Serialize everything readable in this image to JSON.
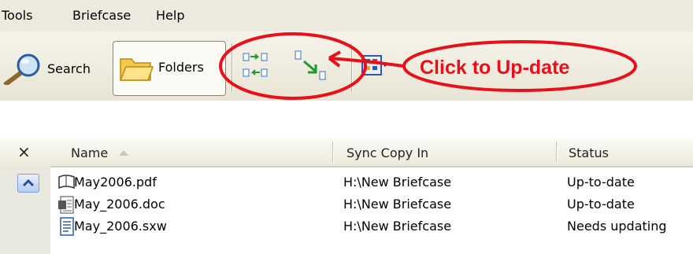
{
  "menu": {
    "tools": "Tools",
    "briefcase": "Briefcase",
    "help": "Help"
  },
  "toolbar": {
    "search_label": "Search",
    "folders_label": "Folders"
  },
  "annotation": {
    "text": "Click to Up-date",
    "color": "#e8101a"
  },
  "list": {
    "close_symbol": "×",
    "columns": {
      "name": "Name",
      "sync": "Sync Copy In",
      "status": "Status"
    },
    "rows": [
      {
        "name": "May2006.pdf",
        "sync": "H:\\New Briefcase",
        "status": "Up-to-date",
        "icon": "pdf-icon"
      },
      {
        "name": "May_2006.doc",
        "sync": "H:\\New Briefcase",
        "status": "Up-to-date",
        "icon": "doc-icon"
      },
      {
        "name": "May_2006.sxw",
        "sync": "H:\\New Briefcase",
        "status": "Needs updating",
        "icon": "sxw-icon"
      }
    ]
  }
}
